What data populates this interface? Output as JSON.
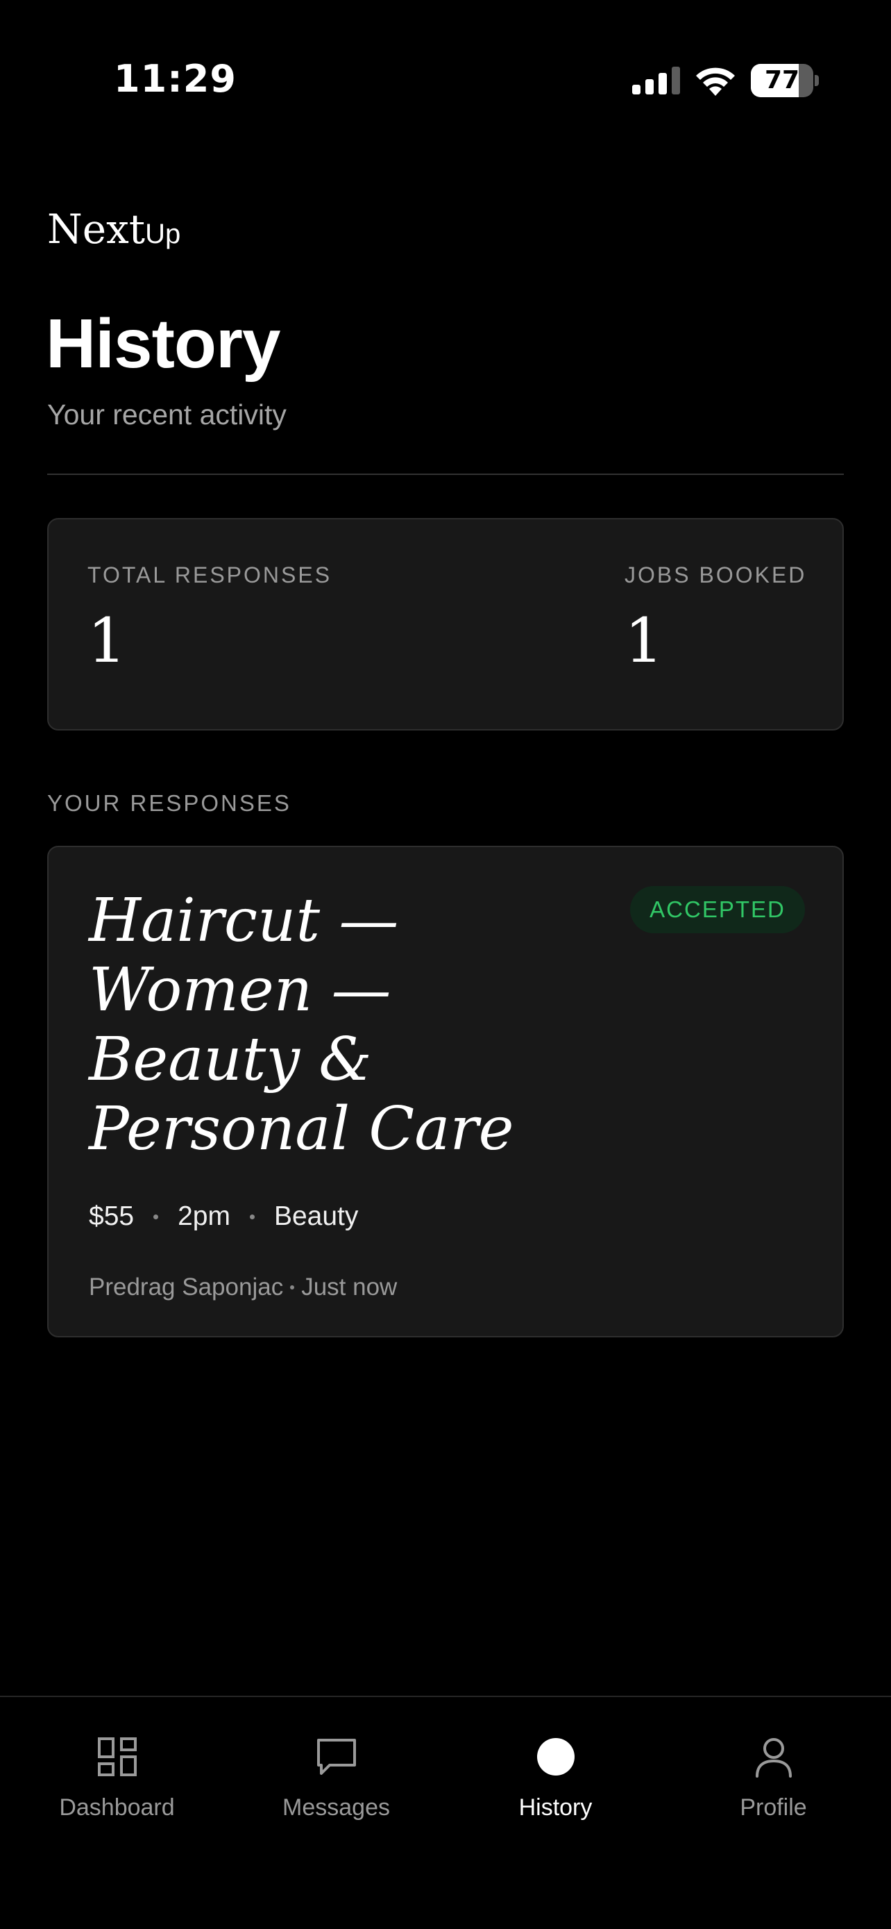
{
  "status_bar": {
    "time": "11:29",
    "battery": "77",
    "battery_level": 0.77
  },
  "brand": {
    "next": "Next",
    "up": "Up"
  },
  "header": {
    "title": "History",
    "subtitle": "Your recent activity"
  },
  "stats": {
    "total_responses_label": "TOTAL RESPONSES",
    "total_responses_value": "1",
    "jobs_booked_label": "JOBS BOOKED",
    "jobs_booked_value": "1"
  },
  "section_label": "YOUR RESPONSES",
  "responses": [
    {
      "title": "Haircut — Women — Beauty & Personal Care",
      "status": "ACCEPTED",
      "price": "$55",
      "time": "2pm",
      "category": "Beauty",
      "client": "Predrag Saponjac",
      "when": "Just now"
    }
  ],
  "tabs": [
    {
      "label": "Dashboard",
      "icon": "dashboard-grid-icon"
    },
    {
      "label": "Messages",
      "icon": "message-bubble-icon"
    },
    {
      "label": "History",
      "icon": "history-dot-icon",
      "active": true
    },
    {
      "label": "Profile",
      "icon": "person-icon"
    }
  ],
  "colors": {
    "accent_green": "#31c766",
    "badge_bg": "#10281a",
    "card_bg": "#181818",
    "background": "#000000"
  }
}
